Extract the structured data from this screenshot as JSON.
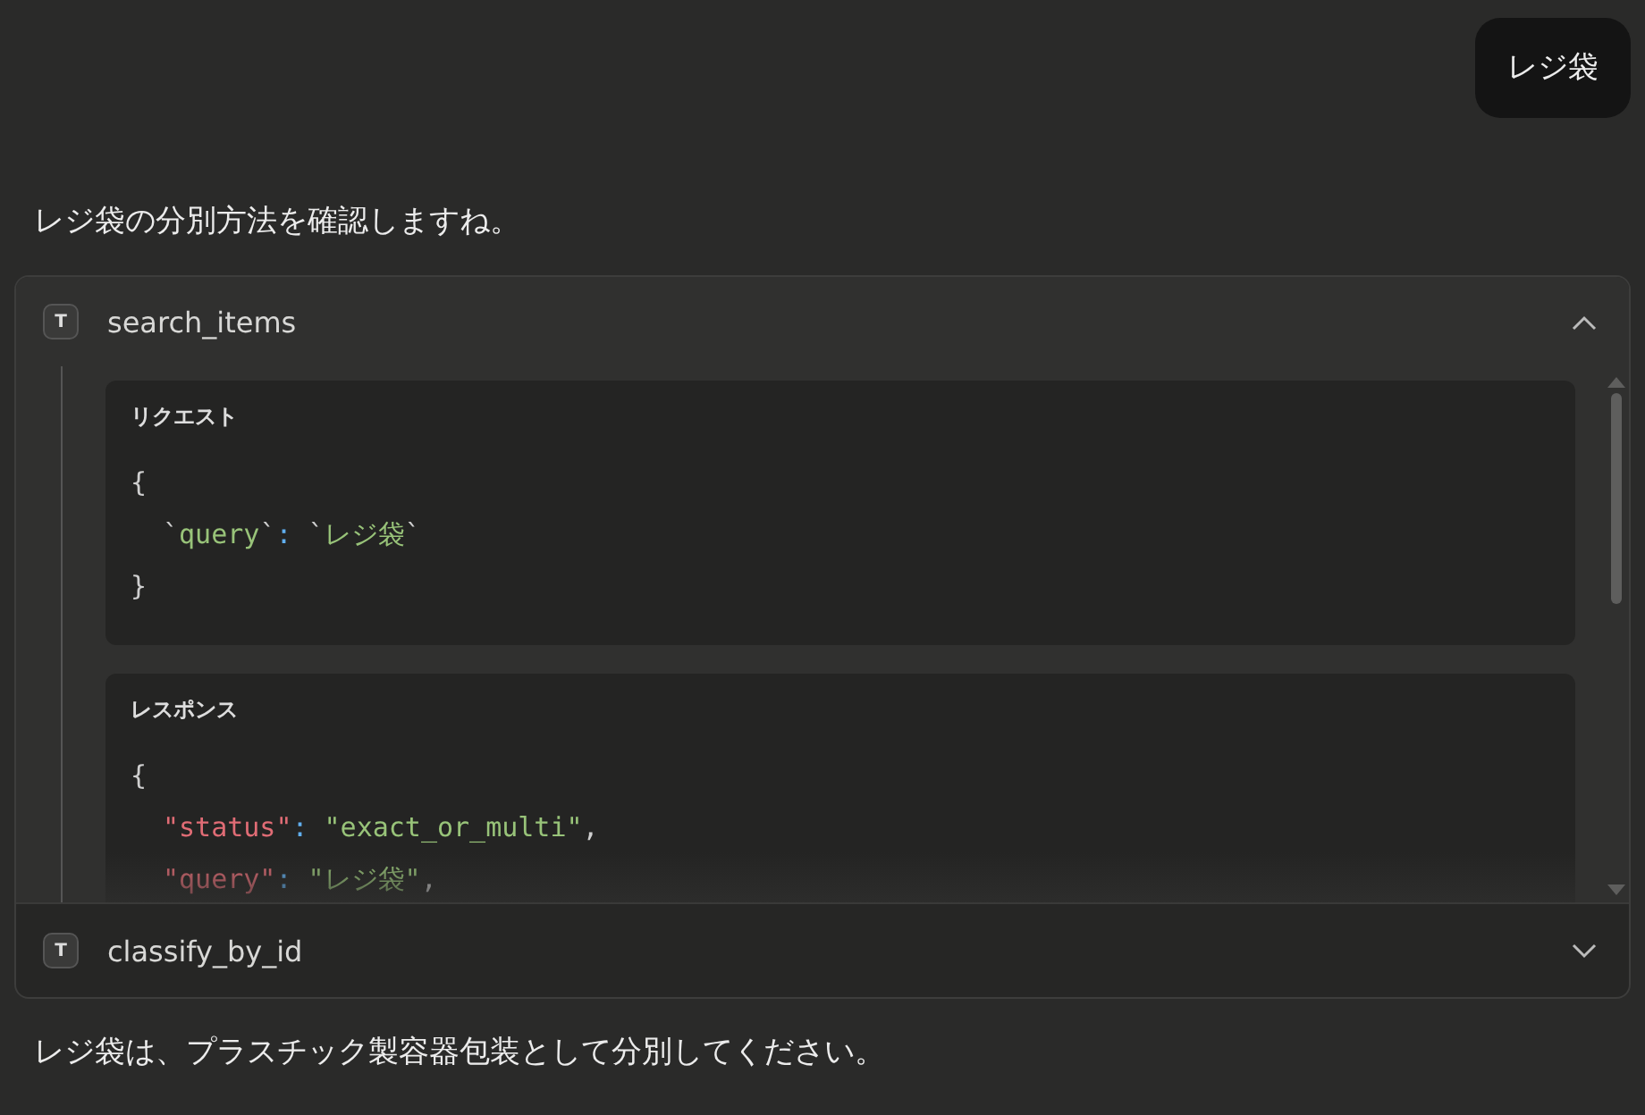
{
  "user_message": "レジ袋",
  "assistant_intro": "レジ袋の分別方法を確認しますね。",
  "tool_calls": [
    {
      "badge": "T",
      "name": "search_items",
      "expanded": true,
      "sections": [
        {
          "title": "リクエスト",
          "lines": [
            {
              "indented": false,
              "tokens": [
                {
                  "text": "{",
                  "kind": "punct"
                }
              ]
            },
            {
              "indented": true,
              "tokens": [
                {
                  "text": "`",
                  "kind": "punct"
                },
                {
                  "text": "query",
                  "kind": "str"
                },
                {
                  "text": "`",
                  "kind": "punct"
                },
                {
                  "text": ":",
                  "kind": "colon"
                },
                {
                  "text": "`",
                  "kind": "punct"
                },
                {
                  "text": "レジ袋",
                  "kind": "str"
                },
                {
                  "text": "`",
                  "kind": "punct"
                }
              ]
            },
            {
              "indented": false,
              "tokens": [
                {
                  "text": "}",
                  "kind": "punct"
                }
              ]
            }
          ]
        },
        {
          "title": "レスポンス",
          "lines": [
            {
              "indented": false,
              "tokens": [
                {
                  "text": "{",
                  "kind": "punct"
                }
              ]
            },
            {
              "indented": true,
              "tokens": [
                {
                  "text": "\"status\"",
                  "kind": "key"
                },
                {
                  "text": ":",
                  "kind": "colon"
                },
                {
                  "text": "\"exact_or_multi\"",
                  "kind": "str"
                },
                {
                  "text": ",",
                  "kind": "punct"
                }
              ]
            },
            {
              "indented": true,
              "tokens": [
                {
                  "text": "\"query\"",
                  "kind": "key"
                },
                {
                  "text": ":",
                  "kind": "colon"
                },
                {
                  "text": "\"レジ袋\"",
                  "kind": "str"
                },
                {
                  "text": ",",
                  "kind": "punct"
                }
              ]
            }
          ]
        }
      ]
    },
    {
      "badge": "T",
      "name": "classify_by_id",
      "expanded": false
    }
  ],
  "assistant_answer": "レジ袋は、プラスチック製容器包装として分別してください。"
}
